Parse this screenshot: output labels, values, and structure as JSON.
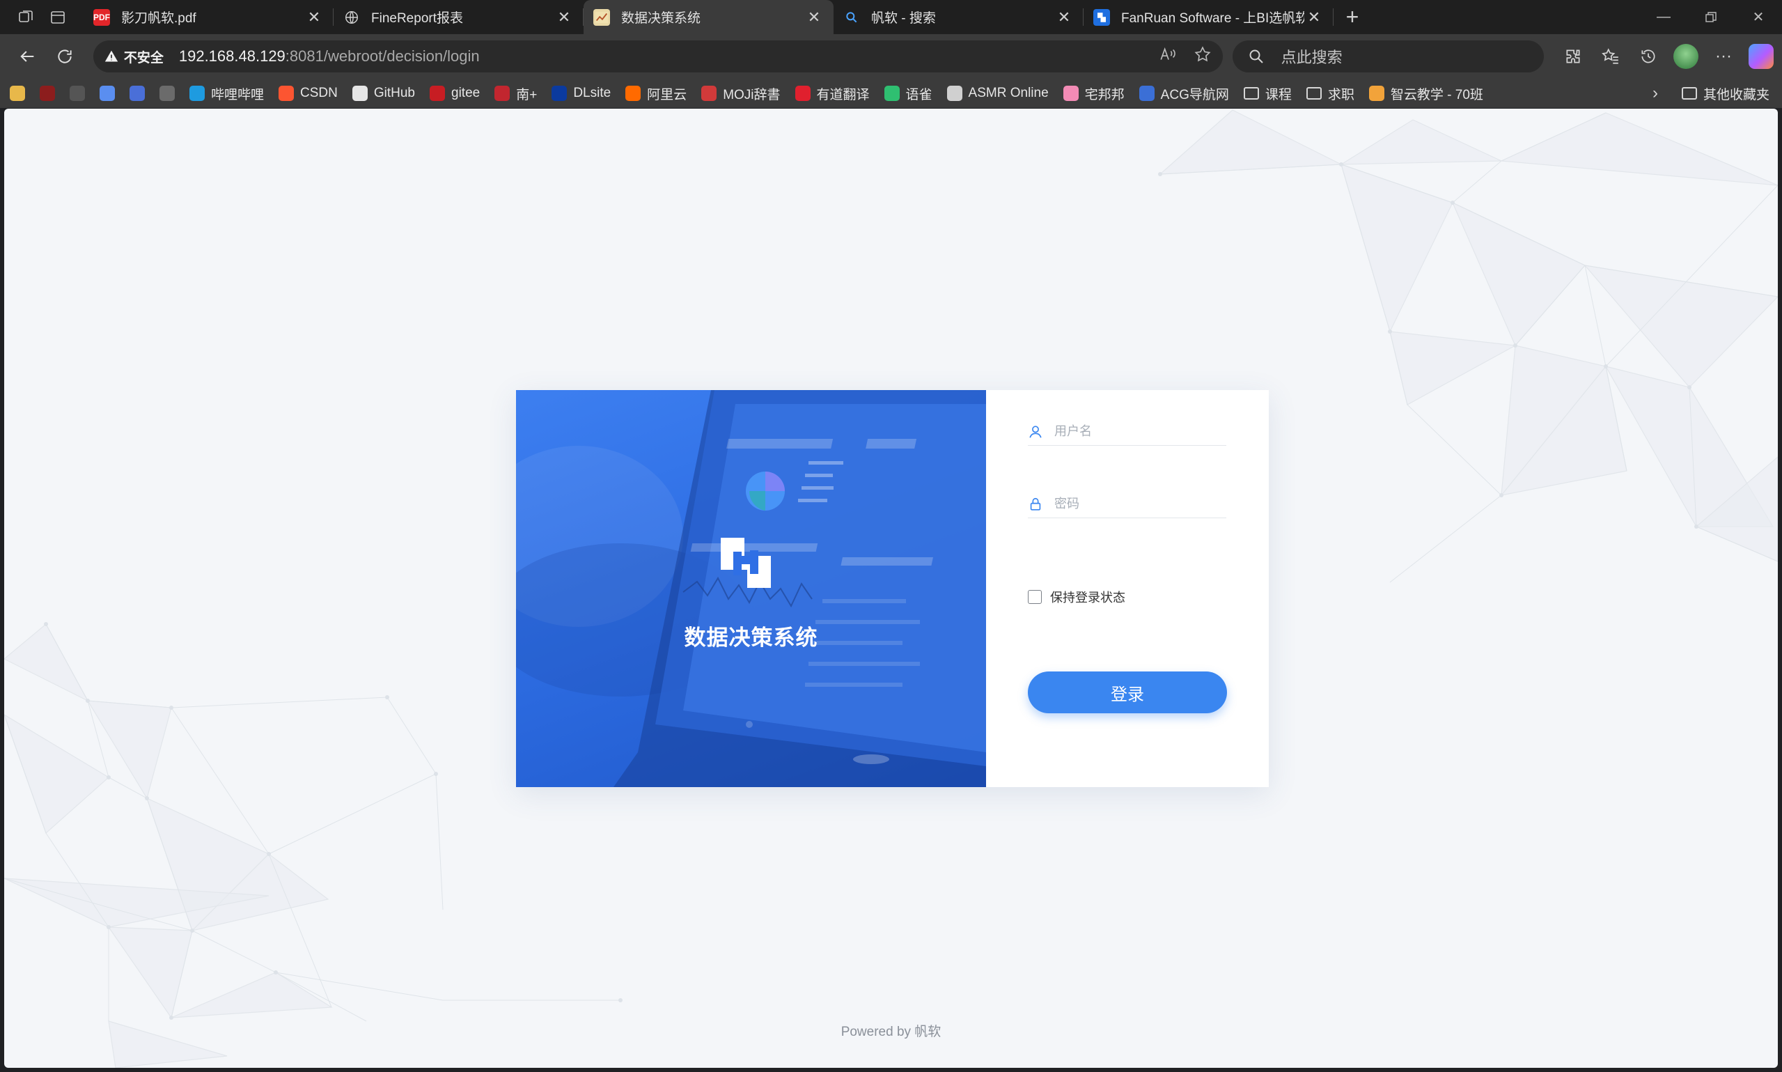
{
  "browser": {
    "tabs": [
      {
        "title": "影刀帆软.pdf",
        "favicon": "pdf-icon",
        "active": false
      },
      {
        "title": "FineReport报表",
        "favicon": "globe-icon",
        "active": false
      },
      {
        "title": "数据决策系统",
        "favicon": "finereport-icon",
        "active": true
      },
      {
        "title": "帆软 - 搜索",
        "favicon": "bing-search-icon",
        "active": false
      },
      {
        "title": "FanRuan Software - 上BI选帆软,",
        "favicon": "fanruan-icon",
        "active": false
      }
    ],
    "security_label": "不安全",
    "url_host": "192.168.48.129",
    "url_rest": ":8081/webroot/decision/login",
    "search_placeholder": "点此搜索",
    "bookmarks": [
      {
        "label": "",
        "icon": "smiley-icon",
        "color": "#e8b84a"
      },
      {
        "label": "",
        "icon": "anime-icon",
        "color": "#8c1d1d"
      },
      {
        "label": "",
        "icon": "openai-icon",
        "color": "#555555"
      },
      {
        "label": "",
        "icon": "colorful-app-icon",
        "color": "#5a8ef0"
      },
      {
        "label": "",
        "icon": "bird-icon",
        "color": "#4a6fd8"
      },
      {
        "label": "",
        "icon": "portrait-icon",
        "color": "#6b6b6b"
      },
      {
        "label": "哔哩哔哩",
        "icon": "bilibili-icon",
        "color": "#1e9be0"
      },
      {
        "label": "CSDN",
        "icon": "csdn-icon",
        "color": "#fc5531"
      },
      {
        "label": "GitHub",
        "icon": "github-icon",
        "color": "#e6e6e6"
      },
      {
        "label": "gitee",
        "icon": "gitee-icon",
        "color": "#c71d23"
      },
      {
        "label": "南+",
        "icon": "south-plus-icon",
        "color": "#c2262f"
      },
      {
        "label": "DLsite",
        "icon": "dlsite-icon",
        "color": "#0b3a9e"
      },
      {
        "label": "阿里云",
        "icon": "aliyun-icon",
        "color": "#ff6a00"
      },
      {
        "label": "MOJi辞書",
        "icon": "moji-icon",
        "color": "#d13a3a"
      },
      {
        "label": "有道翻译",
        "icon": "youdao-icon",
        "color": "#e0202e"
      },
      {
        "label": "语雀",
        "icon": "yuque-icon",
        "color": "#2fbf71"
      },
      {
        "label": "ASMR Online",
        "icon": "globe-icon",
        "color": "#d0d0d0"
      },
      {
        "label": "宅邦邦",
        "icon": "zhaibang-icon",
        "color": "#f28bb5"
      },
      {
        "label": "ACG导航网",
        "icon": "acg-icon",
        "color": "#3b6fd6"
      },
      {
        "label": "课程",
        "icon": "folder-icon",
        "color": ""
      },
      {
        "label": "求职",
        "icon": "folder-icon",
        "color": ""
      },
      {
        "label": "智云教学 - 70班",
        "icon": "zhiyun-icon",
        "color": "#f2a33a"
      }
    ],
    "other_bookmarks": "其他收藏夹"
  },
  "page": {
    "hero_title": "数据决策系统",
    "username_placeholder": "用户名",
    "password_placeholder": "密码",
    "remember_label": "保持登录状态",
    "login_button": "登录",
    "powered_by": "Powered by 帆软",
    "accent_color": "#3a86f0"
  }
}
